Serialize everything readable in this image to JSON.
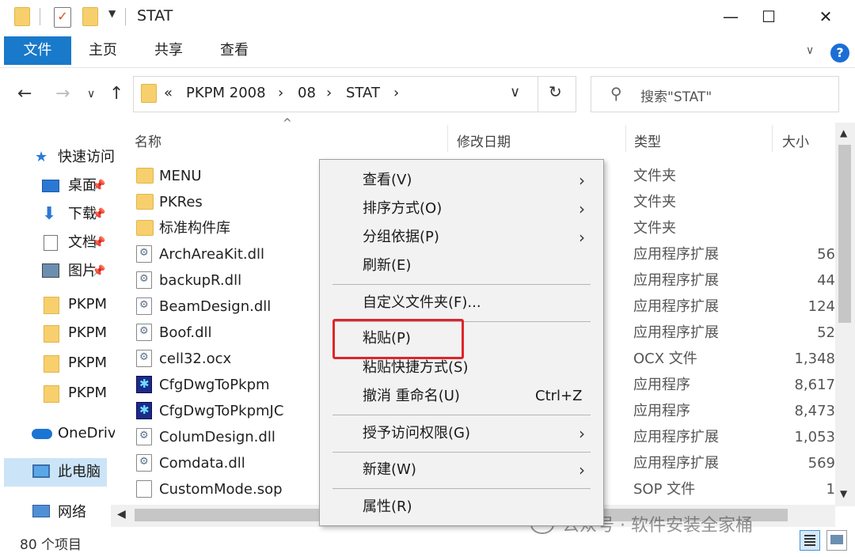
{
  "window": {
    "title": "STAT",
    "minimize": "—",
    "maximize": "☐",
    "close": "✕"
  },
  "ribbon": {
    "tabs": [
      "文件",
      "主页",
      "共享",
      "查看"
    ],
    "collapse": "∨",
    "help": "?"
  },
  "navigation": {
    "back": "←",
    "forward": "→",
    "recent": "∨",
    "up": "↑"
  },
  "address": {
    "overflow": "«",
    "crumbs": [
      "PKPM 2008",
      "08",
      "STAT"
    ],
    "separator": "›",
    "dropdown": "∨",
    "refresh": "↻"
  },
  "search": {
    "placeholder": "搜索\"STAT\"",
    "icon": "search-icon"
  },
  "nav_pane": {
    "items": [
      {
        "label": "快速访问",
        "icon": "star-icon"
      },
      {
        "label": "桌面",
        "icon": "desktop-icon",
        "pinned": true
      },
      {
        "label": "下载",
        "icon": "download-icon",
        "pinned": true
      },
      {
        "label": "文档",
        "icon": "document-icon",
        "pinned": true
      },
      {
        "label": "图片",
        "icon": "picture-icon",
        "pinned": true
      },
      {
        "label": "PKPM",
        "icon": "folder-icon"
      },
      {
        "label": "PKPM",
        "icon": "folder-icon"
      },
      {
        "label": "PKPM",
        "icon": "folder-icon"
      },
      {
        "label": "PKPM",
        "icon": "folder-icon"
      },
      {
        "label": "OneDrive",
        "icon": "cloud-icon"
      },
      {
        "label": "此电脑",
        "icon": "computer-icon",
        "selected": true
      },
      {
        "label": "网络",
        "icon": "network-icon"
      }
    ]
  },
  "columns": {
    "name": "名称",
    "date": "修改日期",
    "type": "类型",
    "size": "大小",
    "sort_indicator": "^"
  },
  "files": [
    {
      "name": "MENU",
      "type": "文件夹",
      "size": "",
      "icon": "folder"
    },
    {
      "name": "PKRes",
      "type": "文件夹",
      "size": "",
      "icon": "folder"
    },
    {
      "name": "标准构件库",
      "type": "文件夹",
      "size": "",
      "icon": "folder"
    },
    {
      "name": "ArchAreaKit.dll",
      "type": "应用程序扩展",
      "size": "56",
      "icon": "dll"
    },
    {
      "name": "backupR.dll",
      "type": "应用程序扩展",
      "size": "44",
      "icon": "dll"
    },
    {
      "name": "BeamDesign.dll",
      "type": "应用程序扩展",
      "size": "124",
      "icon": "dll"
    },
    {
      "name": "Boof.dll",
      "type": "应用程序扩展",
      "size": "52",
      "icon": "dll"
    },
    {
      "name": "cell32.ocx",
      "type": "OCX 文件",
      "size": "1,348",
      "icon": "dll"
    },
    {
      "name": "CfgDwgToPkpm",
      "type": "应用程序",
      "size": "8,617",
      "icon": "app"
    },
    {
      "name": "CfgDwgToPkpmJC",
      "type": "应用程序",
      "size": "8,473",
      "icon": "app"
    },
    {
      "name": "ColumDesign.dll",
      "type": "应用程序扩展",
      "size": "1,053",
      "icon": "dll"
    },
    {
      "name": "Comdata.dll",
      "type": "应用程序扩展",
      "size": "569",
      "icon": "dll"
    },
    {
      "name": "CustomMode.sop",
      "type": "SOP 文件",
      "size": "1",
      "icon": "file"
    }
  ],
  "context_menu": {
    "items": [
      {
        "label": "查看(V)",
        "submenu": true
      },
      {
        "label": "排序方式(O)",
        "submenu": true
      },
      {
        "label": "分组依据(P)",
        "submenu": true
      },
      {
        "label": "刷新(E)"
      },
      {
        "label": "自定义文件夹(F)..."
      },
      {
        "label": "粘贴(P)",
        "highlighted": true
      },
      {
        "label": "粘贴快捷方式(S)"
      },
      {
        "label": "撤消 重命名(U)",
        "shortcut": "Ctrl+Z"
      },
      {
        "label": "授予访问权限(G)",
        "submenu": true
      },
      {
        "label": "新建(W)",
        "submenu": true
      },
      {
        "label": "属性(R)"
      }
    ],
    "submenu_arrow": "›",
    "highlight_color": "#e0242a"
  },
  "status": {
    "item_count": "80 个项目"
  },
  "watermark": {
    "text": "公众号 · 软件安装全家桶"
  },
  "colors": {
    "accent": "#1979ca",
    "selection": "#cce4f7",
    "folder": "#f7d06d"
  }
}
